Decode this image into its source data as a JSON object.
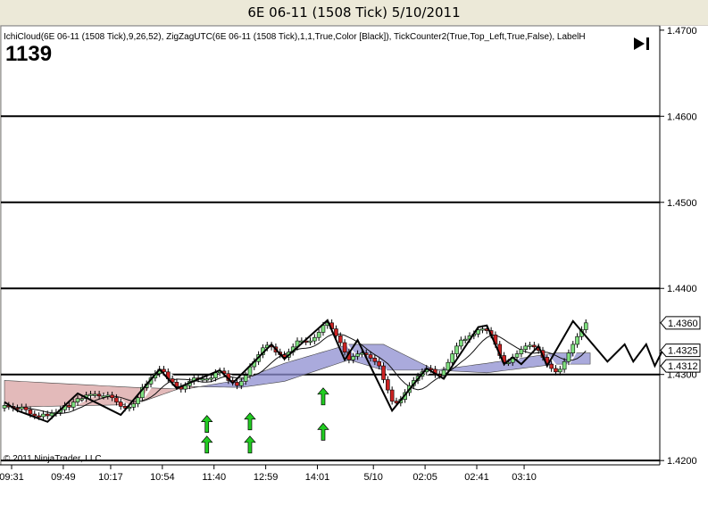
{
  "window": {
    "title": "6E 06-11 (1508 Tick)  5/10/2011"
  },
  "indicator_label": "IchiCloud(6E 06-11 (1508 Tick),9,26,52), ZigZagUTC(6E 06-11 (1508 Tick),1,1,True,Color [Black]), TickCounter2(True,Top_Left,True,False), LabelH",
  "tick_counter": "1139",
  "copyright": "© 2011 NinjaTrader, LLC",
  "icons": {
    "play_to_end": "play-to-end-icon",
    "up_arrow": "up-arrow-icon"
  },
  "colors": {
    "background": "#ffffff",
    "frame": "#d4d0c8",
    "bull_candle": "#7fe07f",
    "bear_candle": "#cc2222",
    "cloud_bull": "#8e8ed0",
    "cloud_bear": "#d9a3a3",
    "zigzag": "#000000",
    "signal_arrow": "#22cc22"
  },
  "chart_data": {
    "type": "candlestick",
    "title": "6E 06-11 (1508 Tick)  5/10/2011",
    "ylim": [
      1.4195,
      1.4705
    ],
    "y_ticks": [
      "1.4700",
      "1.4600",
      "1.4500",
      "1.4400",
      "1.4300",
      "1.4200"
    ],
    "y_tick_values": [
      1.47,
      1.46,
      1.45,
      1.44,
      1.43,
      1.42
    ],
    "x_ticks": [
      "09:31",
      "09:49",
      "10:17",
      "10:54",
      "11:40",
      "12:59",
      "14:01",
      "5/10",
      "02:05",
      "02:41",
      "03:10"
    ],
    "x_tick_positions": [
      0,
      12,
      23,
      35,
      47,
      59,
      71,
      84,
      96,
      108,
      119
    ],
    "price_labels": [
      {
        "label": "1.4360",
        "value": 1.436
      },
      {
        "label": "1.4325",
        "value": 1.4325
      },
      {
        "label": "1.4312",
        "value": 1.4312
      }
    ],
    "horizontal_lines": [
      1.46,
      1.45,
      1.44,
      1.43,
      1.42
    ],
    "bars_count": 136,
    "closes": [
      1.4264,
      1.4263,
      1.4261,
      1.426,
      1.4262,
      1.4259,
      1.4254,
      1.4252,
      1.4251,
      1.4254,
      1.4252,
      1.4255,
      1.4256,
      1.4259,
      1.4264,
      1.4262,
      1.4268,
      1.4272,
      1.4272,
      1.4276,
      1.4277,
      1.4277,
      1.4275,
      1.4275,
      1.4276,
      1.4273,
      1.4268,
      1.4263,
      1.4261,
      1.4262,
      1.4266,
      1.4273,
      1.4285,
      1.4289,
      1.4296,
      1.4301,
      1.4306,
      1.4303,
      1.4295,
      1.4291,
      1.4286,
      1.4283,
      1.4287,
      1.4292,
      1.4296,
      1.4295,
      1.4295,
      1.4295,
      1.4296,
      1.4302,
      1.4304,
      1.4301,
      1.4293,
      1.4291,
      1.4287,
      1.4292,
      1.4299,
      1.4309,
      1.4315,
      1.4323,
      1.4331,
      1.4334,
      1.4332,
      1.4326,
      1.4323,
      1.432,
      1.4326,
      1.4332,
      1.4339,
      1.4339,
      1.4338,
      1.4339,
      1.4343,
      1.4349,
      1.4357,
      1.436,
      1.4353,
      1.4345,
      1.4337,
      1.4326,
      1.4317,
      1.4321,
      1.4324,
      1.4325,
      1.4323,
      1.4319,
      1.4315,
      1.431,
      1.4294,
      1.4282,
      1.4269,
      1.4267,
      1.4271,
      1.4279,
      1.4287,
      1.4293,
      1.4298,
      1.4303,
      1.4307,
      1.4306,
      1.43,
      1.4299,
      1.4305,
      1.4314,
      1.4324,
      1.4333,
      1.434,
      1.4341,
      1.4345,
      1.4347,
      1.4352,
      1.4353,
      1.4351,
      1.4346,
      1.4335,
      1.4322,
      1.4314,
      1.4314,
      1.432,
      1.4324,
      1.4329,
      1.4333,
      1.4334,
      1.4332,
      1.4328,
      1.432,
      1.4312,
      1.4307,
      1.4303,
      1.4306,
      1.4315,
      1.4325,
      1.4335,
      1.4344,
      1.4352,
      1.436
    ],
    "zigzag": [
      {
        "bar": 0,
        "price": 1.4268
      },
      {
        "bar": 3,
        "price": 1.4258
      },
      {
        "bar": 10,
        "price": 1.4245
      },
      {
        "bar": 17,
        "price": 1.4278
      },
      {
        "bar": 27,
        "price": 1.4253
      },
      {
        "bar": 36,
        "price": 1.4306
      },
      {
        "bar": 40,
        "price": 1.4284
      },
      {
        "bar": 50,
        "price": 1.4305
      },
      {
        "bar": 53,
        "price": 1.429
      },
      {
        "bar": 62,
        "price": 1.4335
      },
      {
        "bar": 65,
        "price": 1.4318
      },
      {
        "bar": 75,
        "price": 1.4363
      },
      {
        "bar": 79,
        "price": 1.4317
      },
      {
        "bar": 82,
        "price": 1.434
      },
      {
        "bar": 90,
        "price": 1.4258
      },
      {
        "bar": 98,
        "price": 1.4307
      },
      {
        "bar": 102,
        "price": 1.4295
      },
      {
        "bar": 110,
        "price": 1.4355
      },
      {
        "bar": 112,
        "price": 1.4357
      },
      {
        "bar": 116,
        "price": 1.4312
      },
      {
        "bar": 118,
        "price": 1.432
      },
      {
        "bar": 120,
        "price": 1.4312
      },
      {
        "bar": 124,
        "price": 1.4333
      },
      {
        "bar": 126,
        "price": 1.431
      },
      {
        "bar": 132,
        "price": 1.4362
      },
      {
        "bar": 140,
        "price": 1.4315
      },
      {
        "bar": 144,
        "price": 1.4335
      },
      {
        "bar": 146,
        "price": 1.4315
      },
      {
        "bar": 149,
        "price": 1.4335
      },
      {
        "bar": 151,
        "price": 1.431
      },
      {
        "bar": 153,
        "price": 1.433
      }
    ],
    "cloud": [
      {
        "bar": 0,
        "top": 1.4293,
        "bottom": 1.4262
      },
      {
        "bar": 30,
        "top": 1.4285,
        "bottom": 1.4265
      },
      {
        "bar": 42,
        "top": 1.4283,
        "bottom": 1.4286
      },
      {
        "bar": 55,
        "top": 1.4294,
        "bottom": 1.4285
      },
      {
        "bar": 65,
        "top": 1.4313,
        "bottom": 1.4292
      },
      {
        "bar": 80,
        "top": 1.4335,
        "bottom": 1.4317
      },
      {
        "bar": 88,
        "top": 1.4335,
        "bottom": 1.4305
      },
      {
        "bar": 100,
        "top": 1.4305,
        "bottom": 1.4305
      },
      {
        "bar": 112,
        "top": 1.4313,
        "bottom": 1.4302
      },
      {
        "bar": 128,
        "top": 1.4325,
        "bottom": 1.4312
      },
      {
        "bar": 136,
        "top": 1.4325,
        "bottom": 1.4312
      }
    ],
    "cloud_bull_from_bar": 44,
    "signal_arrows": [
      {
        "bar": 47,
        "price": 1.4242
      },
      {
        "bar": 47,
        "price": 1.4218
      },
      {
        "bar": 57,
        "price": 1.4245
      },
      {
        "bar": 57,
        "price": 1.4218
      },
      {
        "bar": 74,
        "price": 1.4274
      },
      {
        "bar": 74,
        "price": 1.4233
      }
    ]
  }
}
